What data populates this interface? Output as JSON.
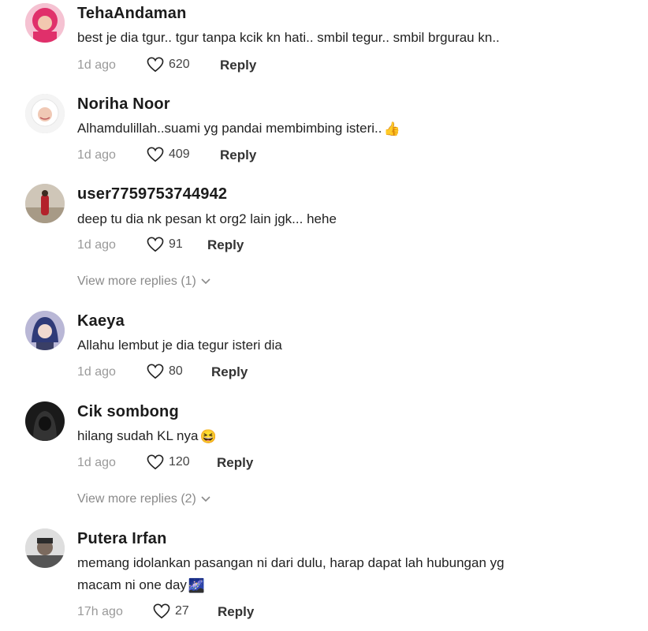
{
  "comments": [
    {
      "username": "TehaAndaman",
      "text": "best je dia tgur.. tgur tanpa kcik kn hati.. smbil tegur.. smbil brgurau kn..",
      "time": "1d ago",
      "likes": "620",
      "reply": "Reply",
      "avatar_icon": "avatar-pink-hijab"
    },
    {
      "username": "Noriha Noor",
      "text": "Alhamdulillah..suami yg pandai membimbing isteri..",
      "emoji": "👍",
      "time": "1d ago",
      "likes": "409",
      "reply": "Reply",
      "avatar_icon": "avatar-white-hijab"
    },
    {
      "username": "user7759753744942",
      "text": "deep tu dia nk pesan kt org2 lain jgk... hehe",
      "time": "1d ago",
      "likes": "91",
      "reply": "Reply",
      "more": "View more replies (1)",
      "avatar_icon": "avatar-red-figure"
    },
    {
      "username": "Kaeya",
      "text": "Allahu lembut je dia tegur isteri dia",
      "time": "1d ago",
      "likes": "80",
      "reply": "Reply",
      "avatar_icon": "avatar-anime"
    },
    {
      "username": "Cik sombong",
      "text": "hilang sudah KL nya",
      "emoji": "😆",
      "time": "1d ago",
      "likes": "120",
      "reply": "Reply",
      "more": "View more replies (2)",
      "avatar_icon": "avatar-hooded"
    },
    {
      "username": "Putera Irfan",
      "text": "memang idolankan pasangan ni dari dulu, harap dapat lah hubungan yg",
      "text2": "macam ni one day",
      "emoji": "🌌",
      "time": "17h ago",
      "likes": "27",
      "reply": "Reply",
      "avatar_icon": "avatar-man"
    }
  ]
}
